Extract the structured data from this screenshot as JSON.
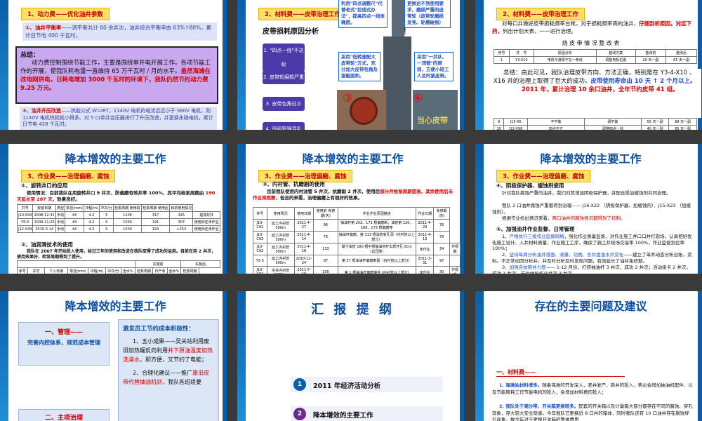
{
  "s1": {
    "tag": "1、动力费——优化油井参数",
    "p1_num": "①、油井平衡率",
    "p1_text": "——调平衡共计 60 余井次，油井综合平衡率由 63%↑80%，累计日节电 400 千瓦时。",
    "summary_title": "总结：",
    "summary_text": "动力费控制围绕节能工作，主要是围绕单井电开展工作。各项节能工作的开展，使我队耗电量一直维持 65 万千瓦时 / 月的水平。",
    "summary_red": "虽然海滩在改电网供电，日耗电增加 3000 千瓦时的环境下，我队仍然节约动力费 9.25 万元。",
    "p4_num": "④、油井升压改造",
    "p4_text": "——热能公式 W=IRT，1140V 电机的电流远远小于 380V 电机，则 1140V 电机热损就小得多。对 5 口单井变压器进行了升压改造，并更换永磁电机，累计日节电 428 千瓦时。"
  },
  "s2": {
    "tag": "2、材料费——皮带治理工作",
    "heading": "皮带损耗原因分析",
    "heading_tail": "理",
    "items": [
      "1. \"四点一线\"不达标",
      "2. 皮带轮磨损严重",
      "3. 皮带包角过小",
      "4. 班组管理混乱"
    ],
    "c1": "利用\"四点调整尺\"代替老式\"拉线式办法\"，提高四点一线准确度。",
    "c2": "更换达不到使用要求、磨损严重的皮带轮（皮带轮磨损发亮、轮槽破损）",
    "c3": "采用\"低转速配大皮带轮\"方式，充分加大皮带包角及接触面积。",
    "c4": "采用\"一井队、一顶替\"的原则，方便小班工人及时紧皮带。",
    "n1": "①",
    "n2": "②",
    "n3": "③",
    "n4": "④",
    "watermark": "当心皮带"
  },
  "s3": {
    "tag": "2、材料费——皮带治理工作",
    "intro_a": "对每口井做好皮带损耗频率台帐，对于损耗频率高的油井，",
    "intro_red": "仔细剖析原因，对症下药，",
    "intro_b": "列出计划大表，一一进行治理。",
    "table_title": "烧 皮 带 情 况 整 改 表",
    "headers": [
      "序号",
      "井　号",
      "原因分析",
      "整改方案",
      "整改前",
      "整改后"
    ],
    "row1": [
      "1",
      "Y3-X10",
      "电机与游梁不在一条线",
      "调整电机位置",
      "10 天一副",
      "65 天一副"
    ],
    "summary_a": "总结：由此可见，我队治理皮带方向、方法正确，特别是在 Y3-4-X10 、 X16 井的治理上取得了巨大的成功。",
    "summary_blue": "皮带使用寿命由 10 天 ↑ 2 个月以上。",
    "summary_red": "2011 年，累计治理 10 余口油井，全年节约皮带 41 组。",
    "rows": [
      [
        "9",
        "J15-X6",
        "不平衡",
        "调平衡",
        "55 天一副",
        "68 天一副"
      ],
      [
        "10",
        "J12-X98",
        "四点不正",
        "调整四点一线",
        "40 天一副",
        "65 天一副"
      ],
      [
        "11",
        "J10-X69",
        "四点不正，皮带轮磨损",
        "更换皮带轮，调整四点",
        "55 天一副",
        "85 天一副"
      ]
    ]
  },
  "s4": {
    "title": "降本增效的主要工作",
    "tag": "3、作业费——治理偏磨、腐蚀",
    "sub": "①、旋转井口的应用",
    "text_a": "使用情况：目前我队在用旋转井口 9 井次，防偏磨有效井率 100%，其平均检泵周期由 ",
    "text_red": "190 天延长至 287 天",
    "text_b": "，效果良好。",
    "headers": [
      "井号",
      "安装日期",
      "类型",
      "泵径(mm)",
      "冲程(m)",
      "冲次/分",
      "检泵周期 使用前",
      "检泵周期 使用后",
      "目前使用情况"
    ],
    "rows": [
      [
        "J10-X94",
        "2008-12-31",
        "手动",
        "44",
        "4.2",
        "3",
        "1106",
        "317",
        "325",
        "提效好井"
      ],
      [
        "Y5-X",
        "2009-11-23",
        "手动",
        "44",
        "4.2",
        "3",
        "1500",
        "191",
        "307",
        "使用旧还未作业"
      ],
      [
        "J12-X44",
        "2010-3-14",
        "手动",
        "44",
        "4.2",
        "3",
        "1500",
        "193",
        "+253",
        "使用旧还未作业"
      ]
    ],
    "sub2": "②、油润滑技术的使用",
    "text2": "我队在 2007 年开始投入使用，经过三年的使用和改进在我队取得了成功的运用。目前在用 2 井次，使用效果好，检泵周期得到了提升。",
    "headers2": [
      "序号",
      "井号",
      "下入日期",
      "泵径(mm)",
      "冲程(m)",
      "冲次/分",
      "含水%",
      "检泵周期",
      "日产液",
      "含水%",
      "检泵周期"
    ],
    "group_a": "实施前",
    "group_b": "实施后",
    "rows2": [
      [
        "1",
        "J12-X46",
        "2007-3-20",
        "44",
        "4.2",
        "3",
        "1356",
        "24.9",
        "97.4",
        "65",
        "31.4",
        "92.9",
        "190"
      ],
      [
        "2",
        "Y5-X7",
        "2010-4-11",
        "44",
        "5",
        "3",
        "1184",
        "19.4",
        "95.8",
        "89",
        "15.9",
        "94.2",
        "169"
      ]
    ]
  },
  "s5": {
    "title": "降本增效的主要工作",
    "tag": "3、作业费——治理偏磨、腐蚀",
    "sub": "③、内衬管、抗磨副的使用",
    "text_a": "目前我队使用内衬油管 5 井次，抗磨副 2 井次，使用后",
    "text_red": "部分井检泵周期提高，其余使用后未作业将观察",
    "text_b": "，但总的来看，治理偏磨上有很好的效果。",
    "headers": [
      "井号",
      "使用情况",
      "使用日期",
      "使用前 免修期(天)",
      "作业作业原因描述",
      "作业日期",
      "免修期(天)"
    ],
    "rows": [
      [
        "J10-C92",
        "延工内衬管 500m",
        "2011-4-27",
        "96",
        "抽油杆第 202、172 根偏磨断，油管第 120、168、173 根偏磨穿",
        "2011-4-23",
        "76"
      ],
      [
        "J10-C93",
        "延工内衬管 500m",
        "2011-4-14",
        "76",
        "抽油杆偏磨，第 113 根油管有孔洞（内衬管以上部分）",
        "2011-4-13",
        "79"
      ],
      [
        "J10-C92",
        "延工内衬管 500m",
        "2011-4-18",
        "133",
        "蜡卡油管 180 根中部抽油管杆出现开孔 8cm（试压降）",
        "未作业",
        "34",
        "作规期"
      ],
      [
        "Y5-5",
        "延工内衬管 500m",
        "2010-12-24",
        "87",
        "第 57 根油油杆偏磨断股（内衬管以上部分）",
        "2011-3-31",
        "97"
      ],
      [
        "J10-C92",
        "全井内衬管 1800m",
        "2011-7-16",
        "100",
        "第 1 根抽油杆偏磨接柱 (内衬管以上部分)",
        "未作业",
        "30",
        "作规期"
      ],
      [
        "J15-X23",
        "抗磨副 100m",
        "2011-3-31",
        "160",
        "第 3 根抽油杆偏磨 (直抽变管段)",
        "未作业",
        "185",
        "作规期"
      ],
      [
        "J10-X69",
        "抗磨副 100m",
        "2011-5-15",
        "605",
        "抽油杆严重偏磨，油管第 89 根对偏磨穿",
        "未作业",
        "181",
        "作规期"
      ]
    ]
  },
  "s6": {
    "title": "降本增效的主要工作",
    "tag": "3、作业费——治理偏磨、腐蚀",
    "sub4": "④、阴极保护器、缓蚀剂使用",
    "p4a": "针对我队腐蚀严重的油井，我们对其增加阴极保护器，并配合投加缓蚀剂共同治理。",
    "p4b": "我队 2 口油井腐蚀严重都得到治理—— J16-X22 （阴极保护器、加缓蚀剂）、J15-X23 （加缓蚀剂）。",
    "p4c_a": "根据作业检出情况来看，",
    "p4c_red": "两口油井的腐蚀情况都得到了控制。",
    "sub5": "⑤、加强油井作业监督、日常管理",
    "p5a_a": "1、",
    "p5a_blue": "严格执行三级作业监督网络",
    "p5a_b": "，强化作业质量监督，对作业施工井口口井打现场，认真把好优化施工设计、入井材料质量、作业施工工序，确保了施工井现场交接率 100%，作业监督到位率 100%；",
    "p5b_a": "2、",
    "p5b_blue": "坚持每周分析油井液面、液量、功图、各井组油水井变化",
    "p5b_b": "——建立了单井动态分析台账，资料。不正常动因分析井。并及时分析及时发现问题，有效延长了油井免修期。",
    "p5c_a": "3、",
    "p5c_blue": "加强自扶铜井力度",
    "p5c_b": "—— 1-12 月份，打捞抽油杆 3 井次，成功 2 井次；活动接卡 2 井次，成功 1 井次。节约维护作业井次 3 井次。"
  },
  "s7": {
    "title": "降本增效的主要工作",
    "box1_title": "一、管理——",
    "box1_text": "完善内控体系，规范成本管理",
    "box2_title": "二、主项治理",
    "r_title": "激发员工节约成本积极性：",
    "r1_a": "1、五小成果——吴关站利用废旧加热罐反向利用",
    "r1_red": "井下原油温度加热洗澡水",
    "r1_b": "，即方便，又节约了电能；",
    "r2_a": "2、合理化建议——推广",
    "r2_red": "废旧皮带代替抽油机刹",
    "r2_b": "，我队各班组要"
  },
  "s8": {
    "title": "汇 报 提 纲",
    "items": [
      {
        "num": "1",
        "text": "2011 年经济活动分析",
        "color": "#0b5ea8"
      },
      {
        "num": "2",
        "text": "降本增效的主要工作",
        "color": "#6a2c91"
      }
    ]
  },
  "s9": {
    "title": "存在的主要问题及建议",
    "section": "一、材料费——",
    "p1_blue": "1. 海滩站材料增多。",
    "p1_text": "随着海滩的开发深入，老井复产，新井的投入，势必会增加抽油机配件、以及节能降耗工作节能电机的投入，会增加材料费的投入；",
    "p2_blue": "2. 我队处于潮沙带，开关箱更换较多。",
    "p2_text": "配套的开关箱以及计量箱大部分都存在不同的腐蚀、穿孔现象，存大较大安全隐患。今年我队已更换近 8 口井的箱体，同时我队还有 10 口油井存在腐蚀穿孔现象，故今年对于更换开关箱的整体费用"
  }
}
